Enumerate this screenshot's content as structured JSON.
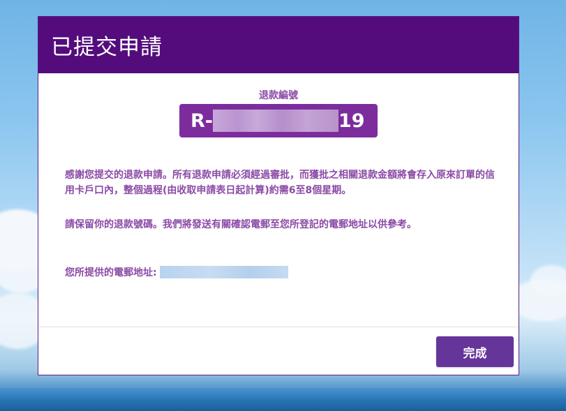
{
  "dialog": {
    "title": "已提交申請",
    "ref_label": "退款編號",
    "ref_prefix": "R-",
    "ref_suffix": "19",
    "message_1": "感謝您提交的退款申請。所有退款申請必須經過審批，而獲批之相關退款金額將會存入原來訂單的信用卡戶口內，整個過程(由收取申請表日起計算)約需6至8個星期。",
    "message_2": "請保留你的退款號碼。我們將發送有關確認電郵至您所登記的電郵地址以供參考。",
    "email_label": "您所提供的電郵地址:",
    "done_label": "完成"
  },
  "colors": {
    "header": "#540c7d",
    "accent_text": "#8b4aa6",
    "ref_box": "#7d2c9e",
    "button": "#66359a"
  }
}
